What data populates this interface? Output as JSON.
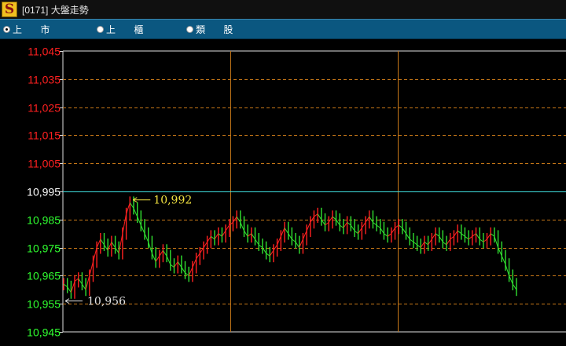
{
  "window": {
    "title": "[0171] 大盤走勢",
    "icon_letter": "S"
  },
  "toolbar": {
    "options": [
      {
        "label": "上 市",
        "selected": true
      },
      {
        "label": "上 櫃",
        "selected": false
      },
      {
        "label": "類 股",
        "selected": false
      }
    ]
  },
  "colors": {
    "up": "#ff2020",
    "down": "#30e030",
    "ref_line": "#40e0e0",
    "grid": "#c87818",
    "frame": "#e0e0e0",
    "label_up": "#ff2020",
    "label_down": "#30ff30",
    "label_ref": "#ffffff",
    "high_marker": "#f0e040",
    "low_marker": "#e0e0e0"
  },
  "chart_data": {
    "type": "line",
    "y_ticks": [
      "11,045",
      "11,035",
      "11,025",
      "11,015",
      "11,005",
      "10,995",
      "10,985",
      "10,975",
      "10,965",
      "10,955",
      "10,945"
    ],
    "ylim": [
      10945,
      11045
    ],
    "reference": 10995,
    "high": {
      "value": 10992,
      "label": "10,992"
    },
    "low": {
      "value": 10956,
      "label": "10,956"
    },
    "x_sections": 3,
    "series": [
      {
        "values": [
          10962,
          10961,
          10959,
          10963,
          10964,
          10962,
          10960,
          10965,
          10970,
          10975,
          10978,
          10976,
          10974,
          10977,
          10975,
          10973,
          10980,
          10987,
          10991,
          10989,
          10986,
          10983,
          10980,
          10977,
          10973,
          10970,
          10972,
          10974,
          10972,
          10969,
          10968,
          10970,
          10968,
          10966,
          10965,
          10968,
          10971,
          10973,
          10975,
          10977,
          10979,
          10978,
          10980,
          10979,
          10981,
          10983,
          10984,
          10986,
          10984,
          10981,
          10979,
          10980,
          10978,
          10976,
          10975,
          10973,
          10972,
          10974,
          10976,
          10979,
          10982,
          10980,
          10978,
          10977,
          10975,
          10978,
          10981,
          10984,
          10986,
          10987,
          10985,
          10983,
          10984,
          10986,
          10985,
          10983,
          10982,
          10984,
          10983,
          10981,
          10980,
          10982,
          10984,
          10986,
          10984,
          10983,
          10982,
          10980,
          10979,
          10980,
          10982,
          10983,
          10982,
          10980,
          10978,
          10977,
          10976,
          10975,
          10977,
          10976,
          10978,
          10980,
          10979,
          10977,
          10976,
          10978,
          10979,
          10981,
          10980,
          10979,
          10978,
          10979,
          10980,
          10978,
          10977,
          10978,
          10980,
          10979,
          10975,
          10972,
          10969,
          10965,
          10962,
          10960
        ]
      }
    ]
  }
}
